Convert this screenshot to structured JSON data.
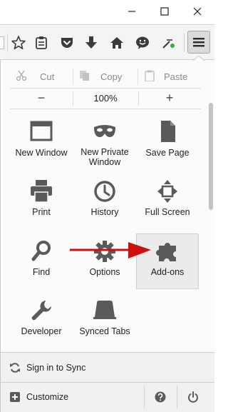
{
  "edit": {
    "cut_label": "Cut",
    "copy_label": "Copy",
    "paste_label": "Paste"
  },
  "zoom": {
    "minus_label": "−",
    "level": "100%",
    "plus_label": "+"
  },
  "menu_items": [
    {
      "label": "New Window",
      "icon": "new-window-icon"
    },
    {
      "label": "New Private Window",
      "icon": "private-mask-icon"
    },
    {
      "label": "Save Page",
      "icon": "save-page-icon"
    },
    {
      "label": "Print",
      "icon": "printer-icon"
    },
    {
      "label": "History",
      "icon": "clock-icon"
    },
    {
      "label": "Full Screen",
      "icon": "fullscreen-icon"
    },
    {
      "label": "Find",
      "icon": "magnifier-icon"
    },
    {
      "label": "Options",
      "icon": "gear-icon"
    },
    {
      "label": "Add-ons",
      "icon": "puzzle-icon"
    },
    {
      "label": "Developer",
      "icon": "wrench-icon"
    },
    {
      "label": "Synced Tabs",
      "icon": "synced-tabs-icon"
    }
  ],
  "footer": {
    "sync_label": "Sign in to Sync",
    "customize_label": "Customize"
  },
  "colors": {
    "arrow": "#cc1111",
    "icon": "#5a5a5a",
    "highlight": "#ebebeb"
  }
}
